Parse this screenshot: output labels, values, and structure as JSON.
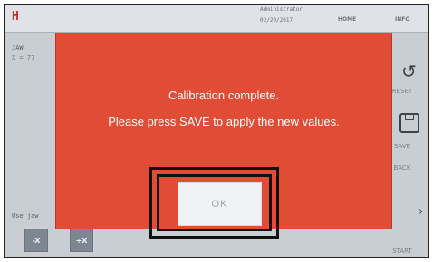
{
  "topbar": {
    "logo": "H",
    "user": "Administrator",
    "date": "02/20/2017",
    "home_tab": "HOME",
    "info_tab": "INFO"
  },
  "left_panel": {
    "label": "JAW",
    "value": "X = 77"
  },
  "bottom_bar": {
    "hint": "Use jaw",
    "minus_x": "-X",
    "plus_x": "+X"
  },
  "side_panel": {
    "reset_label": "RESET",
    "save_label": "SAVE",
    "back_label": "BACK",
    "start_label": "START"
  },
  "dialog": {
    "line1": "Calibration complete.",
    "line2": "Please press SAVE to apply the new values.",
    "ok_label": "OK"
  },
  "colors": {
    "dialog_bg": "#e14c36",
    "highlight_border": "#111111",
    "button_bg": "#f1f2f3"
  }
}
